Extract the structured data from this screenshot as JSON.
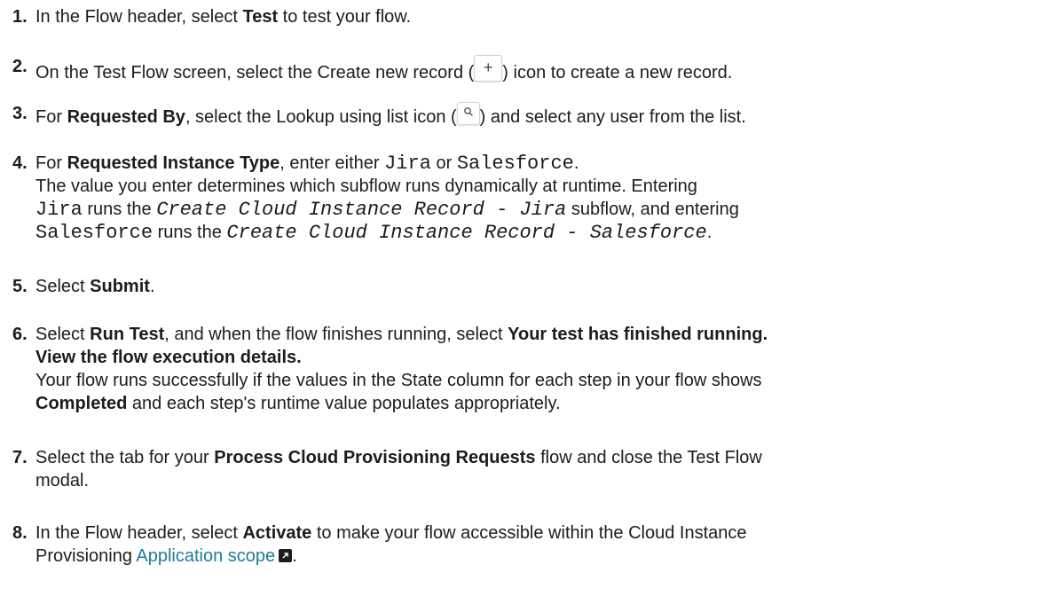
{
  "steps": [
    {
      "num": "1.",
      "a": "In the Flow header, select ",
      "b": "Test",
      "c": " to test your flow."
    },
    {
      "num": "2.",
      "a": "On the Test Flow screen, select the Create new record (",
      "icon": "+",
      "c": ") icon to create a new record."
    },
    {
      "num": "3.",
      "a": "For ",
      "b": "Requested By",
      "c": ", select the Lookup using list icon (",
      "d": ") and select any user from the list."
    },
    {
      "num": "4.",
      "a": "For ",
      "b": "Requested Instance Type",
      "c": ", enter either ",
      "code1": "Jira",
      "d": " or ",
      "code2": "Salesforce",
      "e": ".",
      "l2": "The value you enter determines which subflow runs dynamically at runtime. Entering",
      "l3code": "Jira",
      "l3a": " runs the ",
      "l3italic": "Create Cloud Instance Record - Jira",
      "l3b": " subflow, and entering",
      "l4code": "Salesforce",
      "l4a": " runs the ",
      "l4italic": "Create Cloud Instance Record - Salesforce",
      "l4b": "."
    },
    {
      "num": "5.",
      "a": "Select ",
      "b": "Submit",
      "c": "."
    },
    {
      "num": "6.",
      "a": "Select ",
      "b": "Run Test",
      "c": ", and when the flow finishes running, select ",
      "d": "Your test has finished running.",
      "l2bold": "View the flow execution details.",
      "l3": "Your flow runs successfully if the values in the State column for each step in your flow shows",
      "l4bold": "Completed",
      "l4a": " and each step's runtime value populates appropriately."
    },
    {
      "num": "7.",
      "a": "Select the tab for your ",
      "b": "Process Cloud Provisioning Requests",
      "c": " flow and close the Test Flow",
      "l2": "modal."
    },
    {
      "num": "8.",
      "a": "In the Flow header, select ",
      "b": "Activate",
      "c": " to make your flow accessible within the Cloud Instance",
      "l2": "Provisioning ",
      "link": "Application scope",
      "l2end": "."
    }
  ],
  "icons": {
    "create_record": "plus-icon",
    "lookup": "search-icon",
    "external_link": "external-link-icon"
  },
  "colors": {
    "text": "#1c1c1c",
    "link": "#1f7a9b"
  }
}
